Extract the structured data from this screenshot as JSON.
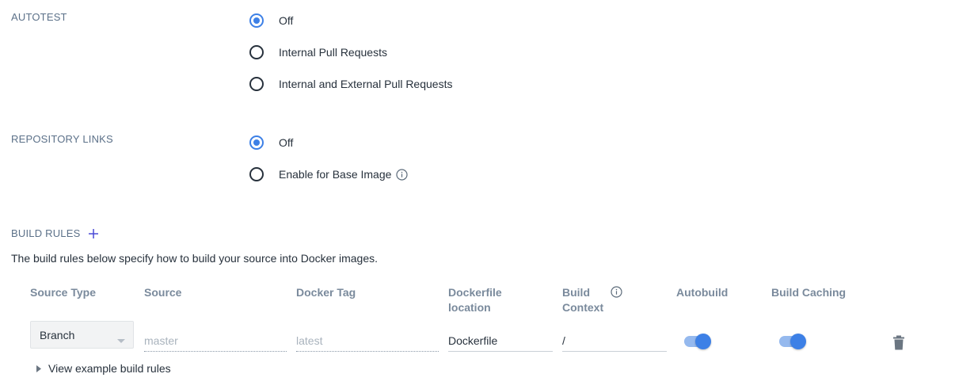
{
  "autotest": {
    "label": "AUTOTEST",
    "options": [
      "Off",
      "Internal Pull Requests",
      "Internal and External Pull Requests"
    ],
    "selected": "Off"
  },
  "repository_links": {
    "label": "REPOSITORY LINKS",
    "options": [
      "Off",
      "Enable for Base Image"
    ],
    "selected": "Off"
  },
  "build_rules": {
    "label": "BUILD RULES",
    "description": "The build rules below specify how to build your source into Docker images.",
    "columns": {
      "source_type": "Source Type",
      "source": "Source",
      "docker_tag": "Docker Tag",
      "dockerfile_location_1": "Dockerfile",
      "dockerfile_location_2": "location",
      "build_context_1": "Build",
      "build_context_2": "Context",
      "autobuild": "Autobuild",
      "build_caching": "Build Caching"
    },
    "rule": {
      "source_type": "Branch",
      "source_placeholder": "master",
      "docker_tag_placeholder": "latest",
      "dockerfile_location": "Dockerfile",
      "build_context": "/",
      "autobuild": true,
      "build_caching": true
    },
    "view_examples": "View example build rules"
  },
  "colors": {
    "accent": "#3d80e6",
    "toggle_track": "#95b9ee",
    "section_label": "#5c7189",
    "column_header": "#7a8a9c"
  },
  "icons": {
    "info": "info-circle-icon",
    "add": "plus-icon",
    "select_caret": "caret-down-icon",
    "delete": "trash-icon",
    "expand": "caret-right-icon"
  }
}
